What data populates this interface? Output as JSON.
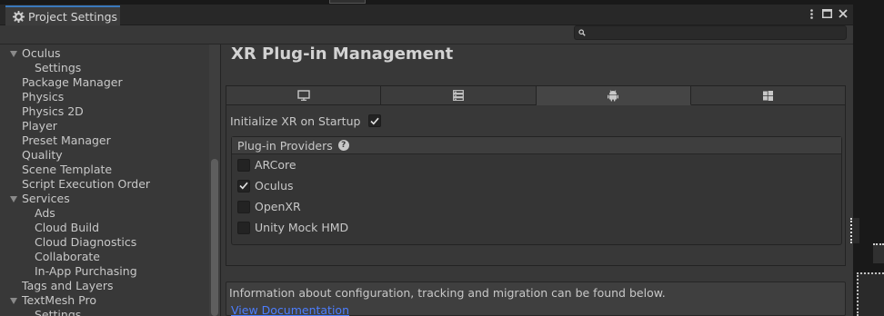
{
  "window": {
    "tab_title": "Project Settings",
    "search": {
      "value": "",
      "placeholder": ""
    }
  },
  "sidebar": {
    "items": [
      {
        "label": "Oculus",
        "level": 0,
        "expanded": true
      },
      {
        "label": "Settings",
        "level": 1
      },
      {
        "label": "Package Manager",
        "level": 0
      },
      {
        "label": "Physics",
        "level": 0
      },
      {
        "label": "Physics 2D",
        "level": 0
      },
      {
        "label": "Player",
        "level": 0
      },
      {
        "label": "Preset Manager",
        "level": 0
      },
      {
        "label": "Quality",
        "level": 0
      },
      {
        "label": "Scene Template",
        "level": 0
      },
      {
        "label": "Script Execution Order",
        "level": 0
      },
      {
        "label": "Services",
        "level": 0,
        "expanded": true
      },
      {
        "label": "Ads",
        "level": 1
      },
      {
        "label": "Cloud Build",
        "level": 1
      },
      {
        "label": "Cloud Diagnostics",
        "level": 1
      },
      {
        "label": "Collaborate",
        "level": 1
      },
      {
        "label": "In-App Purchasing",
        "level": 1
      },
      {
        "label": "Tags and Layers",
        "level": 0
      },
      {
        "label": "TextMesh Pro",
        "level": 0,
        "expanded": true
      },
      {
        "label": "Settings",
        "level": 1
      }
    ]
  },
  "main": {
    "title": "XR Plug-in Management",
    "platform_tabs": [
      {
        "icon": "monitor-icon",
        "active": false
      },
      {
        "icon": "server-icon",
        "active": false
      },
      {
        "icon": "android-icon",
        "active": true
      },
      {
        "icon": "windows-icon",
        "active": false
      }
    ],
    "init_label": "Initialize XR on Startup",
    "init_checked": true,
    "providers_header": "Plug-in Providers",
    "providers": [
      {
        "label": "ARCore",
        "checked": false
      },
      {
        "label": "Oculus",
        "checked": true
      },
      {
        "label": "OpenXR",
        "checked": false
      },
      {
        "label": "Unity Mock HMD",
        "checked": false
      }
    ],
    "info_text": "Information about configuration, tracking and migration can be found below.",
    "doc_link": "View Documentation"
  },
  "colors": {
    "accent_tab": "#3a79bb",
    "link": "#4c7eff",
    "panel": "#383838",
    "background": "#191919"
  }
}
